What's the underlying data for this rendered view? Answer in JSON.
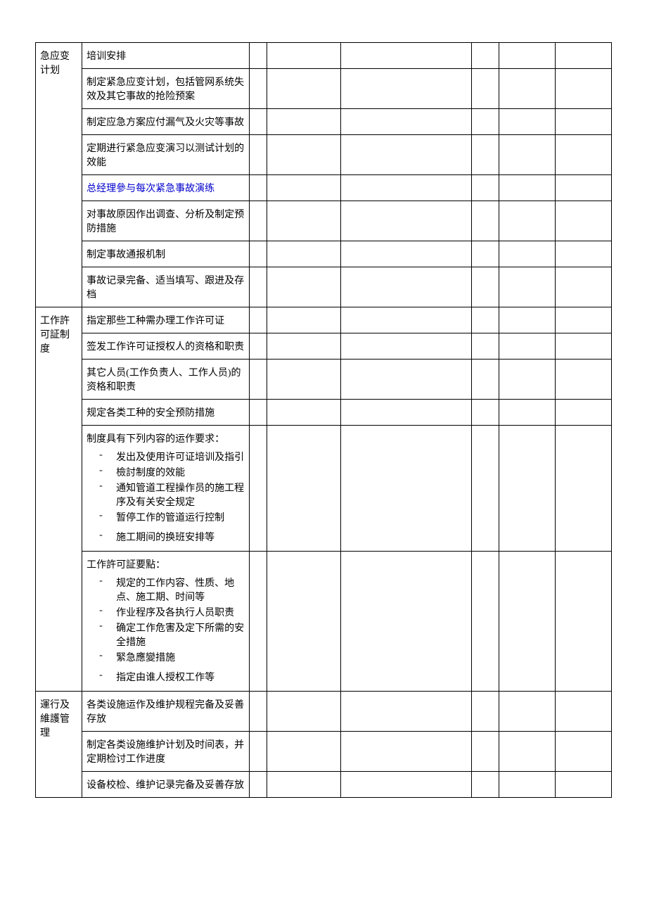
{
  "sections": [
    {
      "category": "急应变计划",
      "rows": [
        {
          "text": "培训安排"
        },
        {
          "text": "制定紧急应变计划，包括管网系统失效及其它事故的抢险预案"
        },
        {
          "text": "制定应急方案应付漏气及火灾等事故"
        },
        {
          "text": "定期进行紧急应变演习以测试计划的效能"
        },
        {
          "text": "总经理參与每次紧急事故演练",
          "blue": true
        },
        {
          "text": "对事故原因作出调查、分析及制定预防措施"
        },
        {
          "text": "制定事故通报机制"
        },
        {
          "text": "事故记录完备、适当填写、跟进及存档"
        }
      ]
    },
    {
      "category": "工作許可証制度",
      "rows": [
        {
          "text": "指定那些工种需办理工作许可证"
        },
        {
          "text": "签发工作许可证授权人的资格和职责"
        },
        {
          "text": "其它人员(工作负责人、工作人员)的资格和职责"
        },
        {
          "text": "规定各类工种的安全预防措施"
        },
        {
          "text": "制度具有下列内容的运作要求：",
          "bullets": [
            "发出及使用许可证培训及指引",
            "檢討制度的效能",
            "通知管道工程操作员的施工程序及有关安全规定",
            "暂停工作的管道运行控制",
            "施工期间的换班安排等"
          ],
          "spacedLast": true
        },
        {
          "text": "工作許可証要點：",
          "bullets": [
            "规定的工作内容、性质、地点、施工期、时间等",
            "作业程序及各执行人员职责",
            "确定工作危害及定下所需的安全措施",
            "緊急應變措施",
            "指定由谁人授权工作等"
          ],
          "spacedLast": true
        }
      ]
    },
    {
      "category": "運行及維護管理",
      "rows": [
        {
          "text": "各类设施运作及维护规程完备及妥善存放"
        },
        {
          "text": "制定各类设施维护计划及时间表，并定期检讨工作进度"
        },
        {
          "text": "设备校检、维护记录完备及妥善存放"
        }
      ]
    }
  ]
}
